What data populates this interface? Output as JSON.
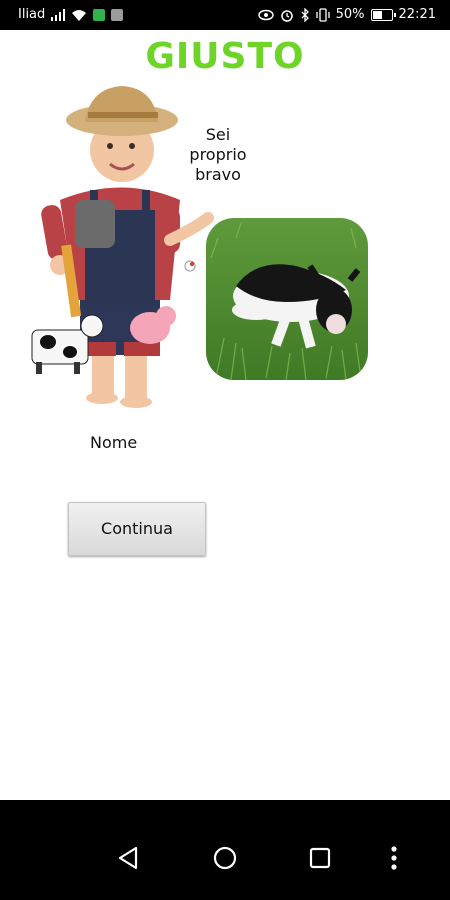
{
  "status_bar": {
    "carrier": "Iliad",
    "battery": "50%",
    "time": "22:21",
    "icons": [
      "signal-icon",
      "wifi-icon",
      "app-notification-icon",
      "gallery-notification-icon",
      "eye-icon",
      "alarm-icon",
      "bluetooth-icon",
      "vibrate-icon",
      "battery-icon"
    ]
  },
  "main": {
    "title": "GIUSTO",
    "title_color": "#6ed528",
    "speech_lines": [
      "Sei",
      "proprio",
      "bravo"
    ],
    "name_label": "Nome",
    "continue_label": "Continua"
  },
  "nav": {
    "icons": [
      "back-icon",
      "home-icon",
      "recents-icon",
      "more-icon"
    ]
  }
}
